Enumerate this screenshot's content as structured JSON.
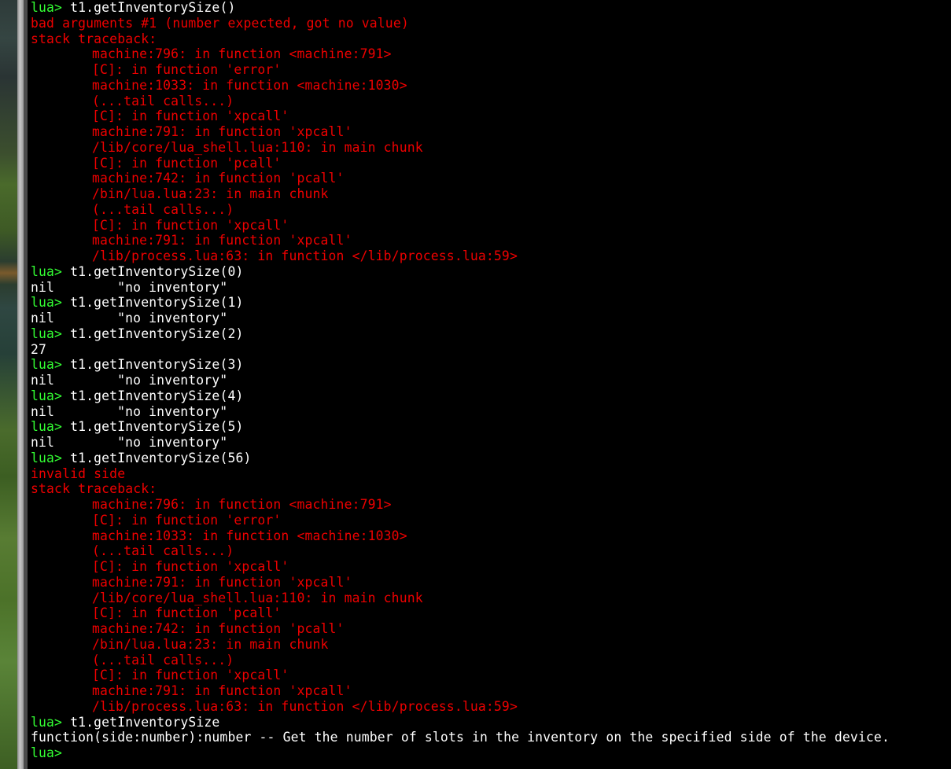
{
  "prompt": "lua>",
  "lines": [
    {
      "kind": "cmd",
      "text": "t1.getInventorySize()"
    },
    {
      "kind": "err",
      "text": "bad arguments #1 (number expected, got no value)"
    },
    {
      "kind": "err",
      "text": "stack traceback:"
    },
    {
      "kind": "tb",
      "text": "machine:796: in function <machine:791>"
    },
    {
      "kind": "tb",
      "text": "[C]: in function 'error'"
    },
    {
      "kind": "tb",
      "text": "machine:1033: in function <machine:1030>"
    },
    {
      "kind": "tb",
      "text": "(...tail calls...)"
    },
    {
      "kind": "tb",
      "text": "[C]: in function 'xpcall'"
    },
    {
      "kind": "tb",
      "text": "machine:791: in function 'xpcall'"
    },
    {
      "kind": "tb",
      "text": "/lib/core/lua_shell.lua:110: in main chunk"
    },
    {
      "kind": "tb",
      "text": "[C]: in function 'pcall'"
    },
    {
      "kind": "tb",
      "text": "machine:742: in function 'pcall'"
    },
    {
      "kind": "tb",
      "text": "/bin/lua.lua:23: in main chunk"
    },
    {
      "kind": "tb",
      "text": "(...tail calls...)"
    },
    {
      "kind": "tb",
      "text": "[C]: in function 'xpcall'"
    },
    {
      "kind": "tb",
      "text": "machine:791: in function 'xpcall'"
    },
    {
      "kind": "tb",
      "text": "/lib/process.lua:63: in function </lib/process.lua:59>"
    },
    {
      "kind": "cmd",
      "text": "t1.getInventorySize(0)"
    },
    {
      "kind": "pair",
      "a": "nil",
      "b": "\"no inventory\""
    },
    {
      "kind": "cmd",
      "text": "t1.getInventorySize(1)"
    },
    {
      "kind": "pair",
      "a": "nil",
      "b": "\"no inventory\""
    },
    {
      "kind": "cmd",
      "text": "t1.getInventorySize(2)"
    },
    {
      "kind": "out",
      "text": "27"
    },
    {
      "kind": "cmd",
      "text": "t1.getInventorySize(3)"
    },
    {
      "kind": "pair",
      "a": "nil",
      "b": "\"no inventory\""
    },
    {
      "kind": "cmd",
      "text": "t1.getInventorySize(4)"
    },
    {
      "kind": "pair",
      "a": "nil",
      "b": "\"no inventory\""
    },
    {
      "kind": "cmd",
      "text": "t1.getInventorySize(5)"
    },
    {
      "kind": "pair",
      "a": "nil",
      "b": "\"no inventory\""
    },
    {
      "kind": "cmd",
      "text": "t1.getInventorySize(56)"
    },
    {
      "kind": "err",
      "text": "invalid side"
    },
    {
      "kind": "err",
      "text": "stack traceback:"
    },
    {
      "kind": "tb",
      "text": "machine:796: in function <machine:791>"
    },
    {
      "kind": "tb",
      "text": "[C]: in function 'error'"
    },
    {
      "kind": "tb",
      "text": "machine:1033: in function <machine:1030>"
    },
    {
      "kind": "tb",
      "text": "(...tail calls...)"
    },
    {
      "kind": "tb",
      "text": "[C]: in function 'xpcall'"
    },
    {
      "kind": "tb",
      "text": "machine:791: in function 'xpcall'"
    },
    {
      "kind": "tb",
      "text": "/lib/core/lua_shell.lua:110: in main chunk"
    },
    {
      "kind": "tb",
      "text": "[C]: in function 'pcall'"
    },
    {
      "kind": "tb",
      "text": "machine:742: in function 'pcall'"
    },
    {
      "kind": "tb",
      "text": "/bin/lua.lua:23: in main chunk"
    },
    {
      "kind": "tb",
      "text": "(...tail calls...)"
    },
    {
      "kind": "tb",
      "text": "[C]: in function 'xpcall'"
    },
    {
      "kind": "tb",
      "text": "machine:791: in function 'xpcall'"
    },
    {
      "kind": "tb",
      "text": "/lib/process.lua:63: in function </lib/process.lua:59>"
    },
    {
      "kind": "cmd",
      "text": "t1.getInventorySize"
    },
    {
      "kind": "out",
      "text": "function(side:number):number -- Get the number of slots in the inventory on the specified side of the device."
    },
    {
      "kind": "cmd",
      "text": ""
    }
  ],
  "colors": {
    "prompt": "#33ff33",
    "output": "#ffffff",
    "error": "#ee0000",
    "background": "#000000"
  }
}
